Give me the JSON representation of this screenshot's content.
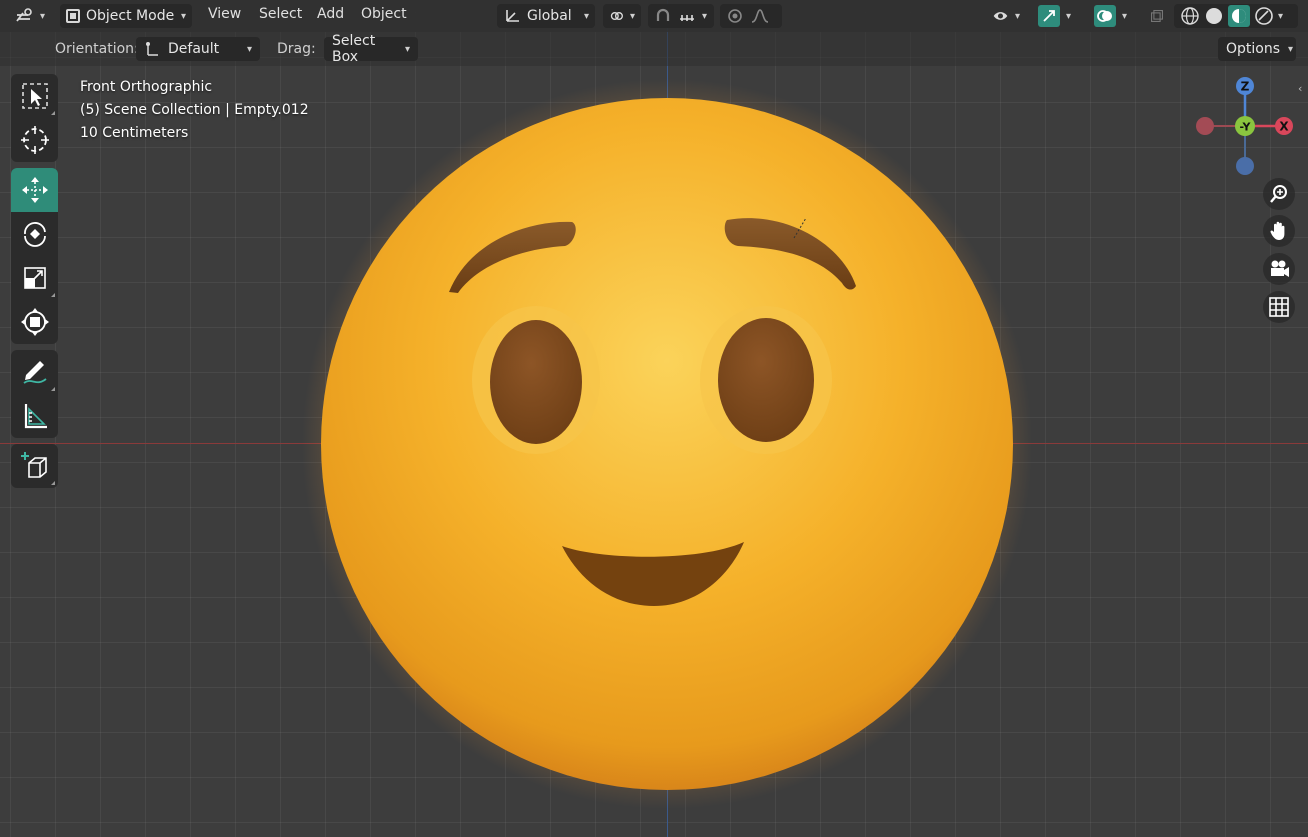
{
  "header": {
    "mode": "Object Mode",
    "menus": [
      "View",
      "Select",
      "Add",
      "Object"
    ],
    "transform_orientation": "Global"
  },
  "tool_settings": {
    "orientation_label": "Orientation:",
    "orientation_value": "Default",
    "drag_label": "Drag:",
    "drag_value": "Select Box",
    "options_label": "Options"
  },
  "viewport_info": {
    "view_name": "Front Orthographic",
    "collection": "(5) Scene Collection | Empty.012",
    "scale": "10 Centimeters"
  },
  "gizmo": {
    "z_label": "Z",
    "y_label": "-Y",
    "x_label": "X"
  },
  "colors": {
    "active_tool": "#2f8c79",
    "axis_x": "#d9475b",
    "axis_y": "#8ac53f",
    "axis_z": "#4f86d6",
    "emoji_yellow": "#f7b52a",
    "feature_brown": "#7a4a1e"
  },
  "toolbar_icons": [
    "select-box-icon",
    "cursor-icon",
    "move-icon",
    "rotate-icon",
    "scale-icon",
    "transform-icon",
    "annotate-icon",
    "measure-icon",
    "add-cube-icon"
  ]
}
